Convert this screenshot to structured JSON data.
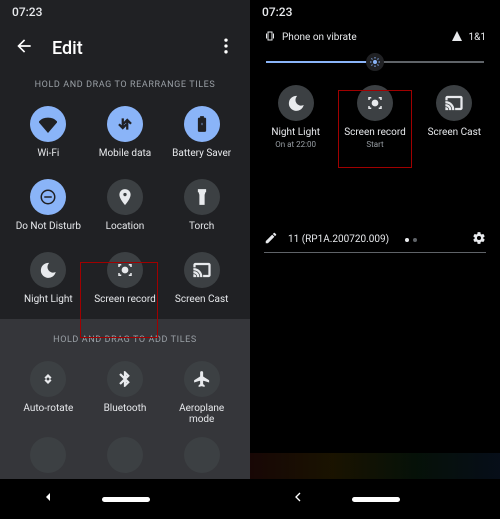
{
  "statusbar": {
    "time": "07:23"
  },
  "left": {
    "title": "Edit",
    "rearrange_label": "HOLD AND DRAG TO REARRANGE TILES",
    "add_label": "HOLD AND DRAG TO ADD TILES",
    "tiles_top": [
      {
        "label": "Wi-Fi"
      },
      {
        "label": "Mobile data"
      },
      {
        "label": "Battery Saver"
      },
      {
        "label": "Do Not Disturb"
      },
      {
        "label": "Location"
      },
      {
        "label": "Torch"
      },
      {
        "label": "Night Light"
      },
      {
        "label": "Screen record"
      },
      {
        "label": "Screen Cast"
      }
    ],
    "tiles_bottom": [
      {
        "label": "Auto-rotate"
      },
      {
        "label": "Bluetooth"
      },
      {
        "label": "Aeroplane mode"
      }
    ]
  },
  "right": {
    "ringer": "Phone on vibrate",
    "signal": "1&1",
    "tiles": [
      {
        "label": "Night Light",
        "sub": "On at 22:00",
        "icon": "moon"
      },
      {
        "label": "Screen record",
        "sub": "Start",
        "icon": "record"
      },
      {
        "label": "Screen Cast",
        "sub": "",
        "icon": "cast"
      }
    ],
    "build": "11 (RP1A.200720.009)"
  }
}
